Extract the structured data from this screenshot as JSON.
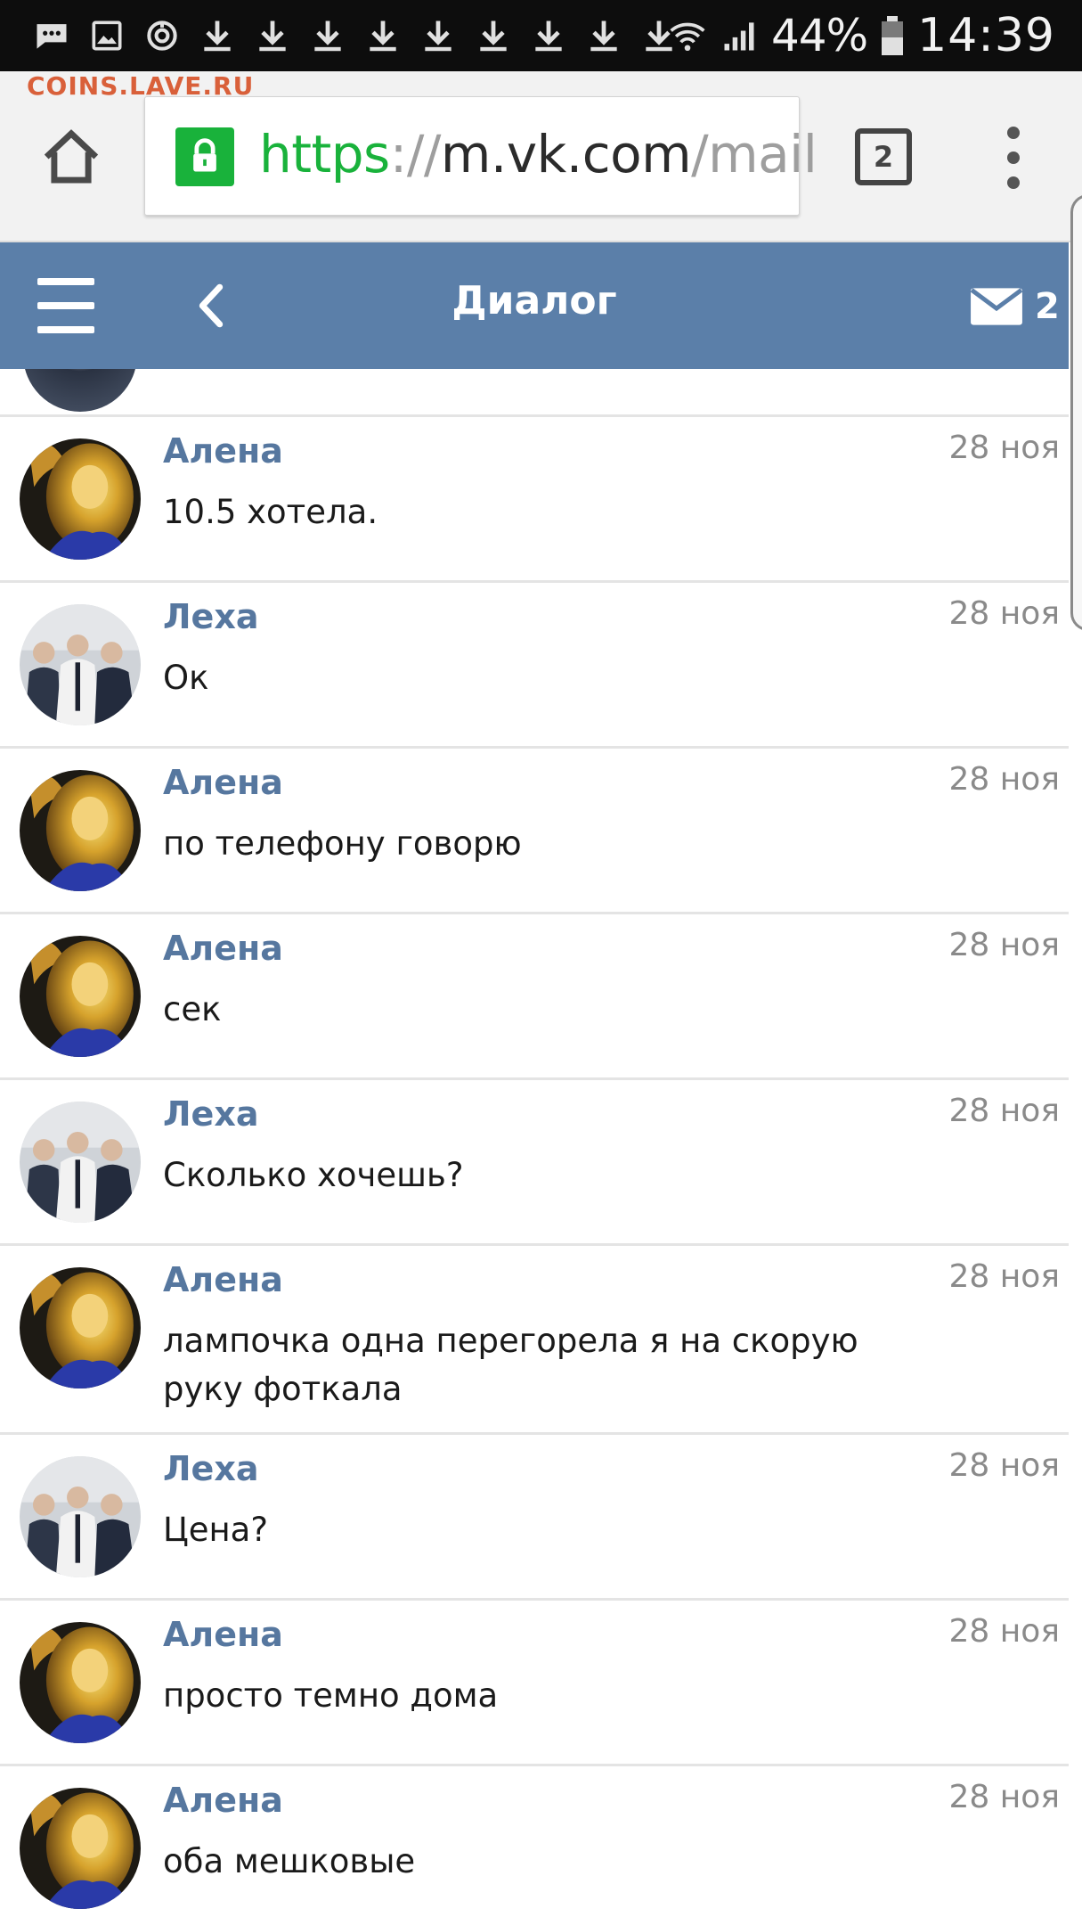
{
  "status_bar": {
    "left_icons": [
      "messages-icon",
      "gallery-icon",
      "sync-icon",
      "download-icon",
      "download-icon",
      "download-icon",
      "download-icon",
      "download-icon",
      "download-icon",
      "download-icon",
      "download-icon",
      "download-icon"
    ],
    "battery_percent": "44%",
    "time": "14:39"
  },
  "watermark": "COINS.LAVE.RU",
  "browser": {
    "url_scheme": "https",
    "url_separator": "://",
    "url_host": "m.vk.com",
    "url_path": "/mail",
    "tab_count": "2",
    "colors": {
      "secure": "#19b23b"
    }
  },
  "header": {
    "title": "Диалог",
    "mail_count": "2",
    "color": "#5b7fa9"
  },
  "messages": [
    {
      "sender": "Алена",
      "avatar": "alena",
      "date": "28 ноя",
      "text": "10.5 хотела."
    },
    {
      "sender": "Леха",
      "avatar": "leha",
      "date": "28 ноя",
      "text": "Ок"
    },
    {
      "sender": "Алена",
      "avatar": "alena",
      "date": "28 ноя",
      "text": "по телефону говорю"
    },
    {
      "sender": "Алена",
      "avatar": "alena",
      "date": "28 ноя",
      "text": "сек"
    },
    {
      "sender": "Леха",
      "avatar": "leha",
      "date": "28 ноя",
      "text": "Сколько хочешь?"
    },
    {
      "sender": "Алена",
      "avatar": "alena",
      "date": "28 ноя",
      "text": "лампочка одна перегорела я на скорую руку фоткала"
    },
    {
      "sender": "Леха",
      "avatar": "leha",
      "date": "28 ноя",
      "text": "Цена?"
    },
    {
      "sender": "Алена",
      "avatar": "alena",
      "date": "28 ноя",
      "text": "просто темно дома"
    },
    {
      "sender": "Алена",
      "avatar": "alena",
      "date": "28 ноя",
      "text": "оба мешковые"
    }
  ]
}
